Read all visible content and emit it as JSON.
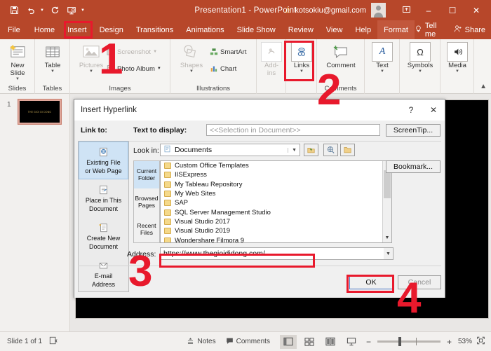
{
  "titlebar": {
    "quick_access": [
      {
        "name": "save-icon",
        "label": "Save"
      },
      {
        "name": "undo-icon",
        "label": "Undo"
      },
      {
        "name": "redo-icon",
        "label": "Redo"
      },
      {
        "name": "start-slideshow-icon",
        "label": "Start From Beginning"
      },
      {
        "name": "customize-qat-icon",
        "label": "Customize Quick Access Toolbar"
      }
    ],
    "title": "Presentation1  -  PowerPoint",
    "warning_icon": "warning-icon",
    "account": "kotsokiu@gmail.com",
    "ribbon_display_options": "ribbon-display-options-icon",
    "minimize": "–",
    "maximize": "☐",
    "close": "✕"
  },
  "tabs": [
    {
      "label": "File",
      "active": false
    },
    {
      "label": "Home",
      "active": false
    },
    {
      "label": "Insert",
      "active": true
    },
    {
      "label": "Design",
      "active": false
    },
    {
      "label": "Transitions",
      "active": false
    },
    {
      "label": "Animations",
      "active": false
    },
    {
      "label": "Slide Show",
      "active": false
    },
    {
      "label": "Review",
      "active": false
    },
    {
      "label": "View",
      "active": false
    },
    {
      "label": "Help",
      "active": false
    },
    {
      "label": "Format",
      "active": false,
      "highlight": true
    }
  ],
  "tabs_right": {
    "tell_me": "Tell me",
    "share": "Share"
  },
  "ribbon": {
    "groups": [
      {
        "label": "Slides"
      },
      {
        "label": "Tables"
      },
      {
        "label": "Images"
      },
      {
        "label": "Illustrations"
      },
      {
        "label": ""
      },
      {
        "label": "Comments"
      },
      {
        "label": ""
      },
      {
        "label": ""
      },
      {
        "label": ""
      }
    ],
    "buttons": {
      "new_slide": "New\nSlide",
      "new_slide_line1": "New",
      "new_slide_line2": "Slide",
      "table": "Table",
      "pictures": "Pictures",
      "screenshot": "Screenshot",
      "photo_album": "Photo Album",
      "shapes": "Shapes",
      "smartart": "SmartArt",
      "chart": "Chart",
      "addins_line1": "Add-",
      "addins_line2": "ins",
      "links": "Links",
      "comment": "Comment",
      "text": "Text",
      "symbols": "Symbols",
      "media": "Media"
    },
    "collapse": "collapse-ribbon-icon"
  },
  "annotations": [
    {
      "number": "1"
    },
    {
      "number": "2"
    },
    {
      "number": "3"
    },
    {
      "number": "4"
    }
  ],
  "thumbnail_pane": {
    "slide_number": "1",
    "slide_text": "THE GIOI DI DONG"
  },
  "dialog": {
    "title": "Insert Hyperlink",
    "help_icon": "?",
    "close_icon": "✕",
    "link_to_label": "Link to:",
    "text_to_display_label": "Text to display:",
    "text_to_display_value": "<<Selection in Document>>",
    "screentip_button": "ScreenTip...",
    "bookmark_button": "Bookmark...",
    "look_in_label": "Look in:",
    "look_in_value": "Documents",
    "look_in_icons": [
      {
        "name": "up-one-level-icon"
      },
      {
        "name": "browse-web-icon"
      },
      {
        "name": "browse-file-icon"
      }
    ],
    "link_to_items": [
      {
        "label_line1": "Existing File",
        "label_line2": "or Web Page",
        "icon": "existing-file-icon",
        "selected": true
      },
      {
        "label_line1": "Place in This",
        "label_line2": "Document",
        "icon": "place-in-document-icon",
        "selected": false
      },
      {
        "label_line1": "Create New",
        "label_line2": "Document",
        "icon": "create-new-document-icon",
        "selected": false
      },
      {
        "label_line1": "E-mail",
        "label_line2": "Address",
        "icon": "email-address-icon",
        "selected": false
      }
    ],
    "side_tabs": [
      {
        "line1": "Current",
        "line2": "Folder",
        "selected": true
      },
      {
        "line1": "Browsed",
        "line2": "Pages",
        "selected": false
      },
      {
        "line1": "Recent",
        "line2": "Files",
        "selected": false
      }
    ],
    "files": [
      "Custom Office Templates",
      "IISExpress",
      "My Tableau Repository",
      "My Web Sites",
      "SAP",
      "SQL Server Management Studio",
      "Visual Studio 2017",
      "Visual Studio 2019",
      "Wondershare Filmora 9"
    ],
    "address_label": "Address:",
    "address_value": "https://www.thegioididong.com/",
    "ok_button": "OK",
    "cancel_button": "Cancel"
  },
  "statusbar": {
    "slide_info": "Slide 1 of 1",
    "accessibility_icon": "accessibility-icon",
    "notes": "Notes",
    "comments": "Comments",
    "views": [
      {
        "name": "normal-view-icon",
        "selected": true
      },
      {
        "name": "slide-sorter-view-icon",
        "selected": false
      },
      {
        "name": "reading-view-icon",
        "selected": false
      },
      {
        "name": "slideshow-view-icon",
        "selected": false
      }
    ],
    "zoom_out": "−",
    "zoom_in": "+",
    "zoom_level": "53%",
    "fit_to_window": "fit-to-window-icon"
  },
  "colors": {
    "ribbon_red": "#b7472a",
    "annotation_red": "#e8192c",
    "selection_blue": "#cfe3f5",
    "slide_black": "#000000",
    "slide_text_gold": "#d9b85c"
  }
}
